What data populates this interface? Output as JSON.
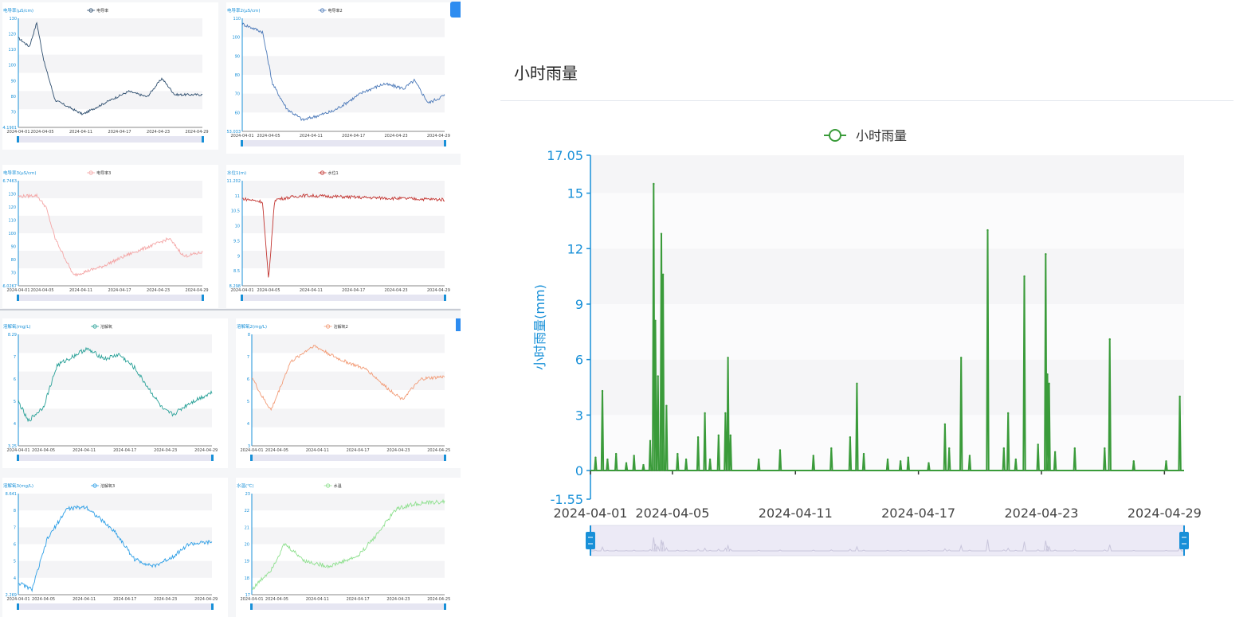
{
  "panel": {
    "title": "小时雨量"
  },
  "colors": {
    "axis": "#1890d8",
    "rain": "#3a9b3a",
    "cond1": "#2f4f6f",
    "cond2": "#4a78b8",
    "cond3": "#f4a6a6",
    "level": "#c23531",
    "do1": "#2aa198",
    "do2": "#f29b76",
    "do3": "#2e9fe6",
    "temp": "#8fe08f"
  },
  "small_charts": [
    {
      "ylabel": "电导率(μS/cm)",
      "legend": "电导率",
      "ytop": "130",
      "ybottom": "64.1901",
      "yticks": [
        "120",
        "110",
        "100",
        "90",
        "80",
        "70"
      ],
      "xticks": [
        "2024-04-01",
        "2024-04-05",
        "2024-04-11",
        "2024-04-17",
        "2024-04-23",
        "2024-04-29"
      ]
    },
    {
      "ylabel": "电导率2(μS/cm)",
      "legend": "电导率2",
      "ytop": "110",
      "ybottom": "53.033",
      "yticks": [
        "100",
        "90",
        "80",
        "70",
        "60"
      ],
      "xticks": [
        "2024-04-01",
        "2024-04-05",
        "2024-04-11",
        "2024-04-17",
        "2024-04-23",
        "2024-04-29"
      ]
    },
    {
      "ylabel": "电导率3(μS/cm)",
      "legend": "电导率3",
      "ytop": "136.7463",
      "ybottom": "66.0267",
      "yticks": [
        "130",
        "120",
        "110",
        "100",
        "90",
        "80",
        "70"
      ],
      "xticks": [
        "2024-04-01",
        "2024-04-05",
        "2024-04-11",
        "2024-04-17",
        "2024-04-23",
        "2024-04-29"
      ]
    },
    {
      "ylabel": "水位1(m)",
      "legend": "水位1",
      "ytop": "11.202",
      "ybottom": "8.298",
      "yticks": [
        "11",
        "10.5",
        "10",
        "9.5",
        "9",
        "8.5"
      ],
      "xticks": [
        "2024-04-01",
        "2024-04-05",
        "2024-04-11",
        "2024-04-17",
        "2024-04-23",
        "2024-04-29"
      ]
    },
    {
      "ylabel": "溶解氧(mg/L)",
      "legend": "溶解氧",
      "ytop": "8.29",
      "ybottom": "3.25",
      "yticks": [
        "7",
        "6",
        "5",
        "4"
      ],
      "xticks": [
        "2024-04-01",
        "2024-04-05",
        "2024-04-11",
        "2024-04-17",
        "2024-04-23",
        "2024-04-29"
      ]
    },
    {
      "ylabel": "溶解氧2(mg/L)",
      "legend": "溶解氧2",
      "ytop": "8",
      "ybottom": "3",
      "yticks": [
        "7",
        "6",
        "5",
        "4"
      ],
      "xticks": [
        "2024-04-01",
        "2024-04-05",
        "2024-04-11",
        "2024-04-17",
        "2024-04-23",
        "2024-04-25"
      ]
    },
    {
      "ylabel": "溶解氧3(mg/L)",
      "legend": "溶解氧3",
      "ytop": "8.641",
      "ybottom": "2.269",
      "yticks": [
        "8",
        "7",
        "6",
        "5",
        "4"
      ],
      "xticks": [
        "2024-04-01",
        "2024-04-05",
        "2024-04-11",
        "2024-04-17",
        "2024-04-23",
        "2024-04-29"
      ]
    },
    {
      "ylabel": "水温(℃)",
      "legend": "水温",
      "ytop": "23",
      "ybottom": "17",
      "yticks": [
        "22",
        "21",
        "20",
        "19",
        "18"
      ],
      "xticks": [
        "2024-04-01",
        "2024-04-05",
        "2024-04-11",
        "2024-04-17",
        "2024-04-23",
        "2024-04-25"
      ]
    }
  ],
  "chart_data": {
    "type": "line",
    "title": "小时雨量",
    "ylabel": "小时雨量(mm)",
    "xlabel": "",
    "legend": "小时雨量",
    "ylim": [
      -1.55,
      17.05
    ],
    "ytick_labels": [
      "17.05",
      "15",
      "12",
      "9",
      "6",
      "3",
      "0",
      "-1.55"
    ],
    "xtick_labels": [
      "2024-04-01",
      "2024-04-05",
      "2024-04-11",
      "2024-04-17",
      "2024-04-23",
      "2024-04-29"
    ],
    "x_start": "2024-04-01",
    "x_end": "2024-04-29 23:00",
    "series": [
      {
        "name": "小时雨量",
        "points": [
          [
            "2024-04-01 06:00",
            0.7
          ],
          [
            "2024-04-01 14:00",
            4.3
          ],
          [
            "2024-04-01 20:00",
            0.6
          ],
          [
            "2024-04-02 06:00",
            0.9
          ],
          [
            "2024-04-02 18:00",
            0.4
          ],
          [
            "2024-04-03 03:00",
            0.8
          ],
          [
            "2024-04-03 14:00",
            0.3
          ],
          [
            "2024-04-03 22:00",
            1.6
          ],
          [
            "2024-04-04 02:00",
            15.5
          ],
          [
            "2024-04-04 04:00",
            8.1
          ],
          [
            "2024-04-04 07:00",
            5.1
          ],
          [
            "2024-04-04 11:00",
            12.8
          ],
          [
            "2024-04-04 13:00",
            10.6
          ],
          [
            "2024-04-04 17:00",
            3.5
          ],
          [
            "2024-04-05 06:00",
            0.9
          ],
          [
            "2024-04-05 16:00",
            0.6
          ],
          [
            "2024-04-06 06:00",
            1.8
          ],
          [
            "2024-04-06 14:00",
            3.1
          ],
          [
            "2024-04-06 20:00",
            0.6
          ],
          [
            "2024-04-07 06:00",
            1.9
          ],
          [
            "2024-04-07 14:00",
            3.1
          ],
          [
            "2024-04-07 17:00",
            6.1
          ],
          [
            "2024-04-07 20:00",
            1.9
          ],
          [
            "2024-04-09 05:00",
            0.6
          ],
          [
            "2024-04-10 06:00",
            1.1
          ],
          [
            "2024-04-11 21:00",
            0.8
          ],
          [
            "2024-04-12 18:00",
            1.2
          ],
          [
            "2024-04-13 16:00",
            1.8
          ],
          [
            "2024-04-14 00:00",
            4.7
          ],
          [
            "2024-04-14 08:00",
            0.9
          ],
          [
            "2024-04-15 12:00",
            0.6
          ],
          [
            "2024-04-16 03:00",
            0.5
          ],
          [
            "2024-04-16 12:00",
            0.7
          ],
          [
            "2024-04-17 12:00",
            0.4
          ],
          [
            "2024-04-18 07:00",
            2.5
          ],
          [
            "2024-04-18 12:00",
            1.2
          ],
          [
            "2024-04-19 02:00",
            6.1
          ],
          [
            "2024-04-19 12:00",
            0.8
          ],
          [
            "2024-04-20 09:00",
            13.0
          ],
          [
            "2024-04-21 04:00",
            1.2
          ],
          [
            "2024-04-21 09:00",
            3.1
          ],
          [
            "2024-04-21 18:00",
            0.6
          ],
          [
            "2024-04-22 04:00",
            10.5
          ],
          [
            "2024-04-22 20:00",
            1.4
          ],
          [
            "2024-04-23 05:00",
            11.7
          ],
          [
            "2024-04-23 07:00",
            5.2
          ],
          [
            "2024-04-23 09:00",
            4.7
          ],
          [
            "2024-04-23 16:00",
            1.0
          ],
          [
            "2024-04-24 15:00",
            1.2
          ],
          [
            "2024-04-26 02:00",
            1.2
          ],
          [
            "2024-04-26 08:00",
            7.1
          ],
          [
            "2024-04-27 12:00",
            0.5
          ],
          [
            "2024-04-29 02:00",
            0.5
          ],
          [
            "2024-04-29 18:00",
            4.0
          ]
        ]
      }
    ]
  }
}
